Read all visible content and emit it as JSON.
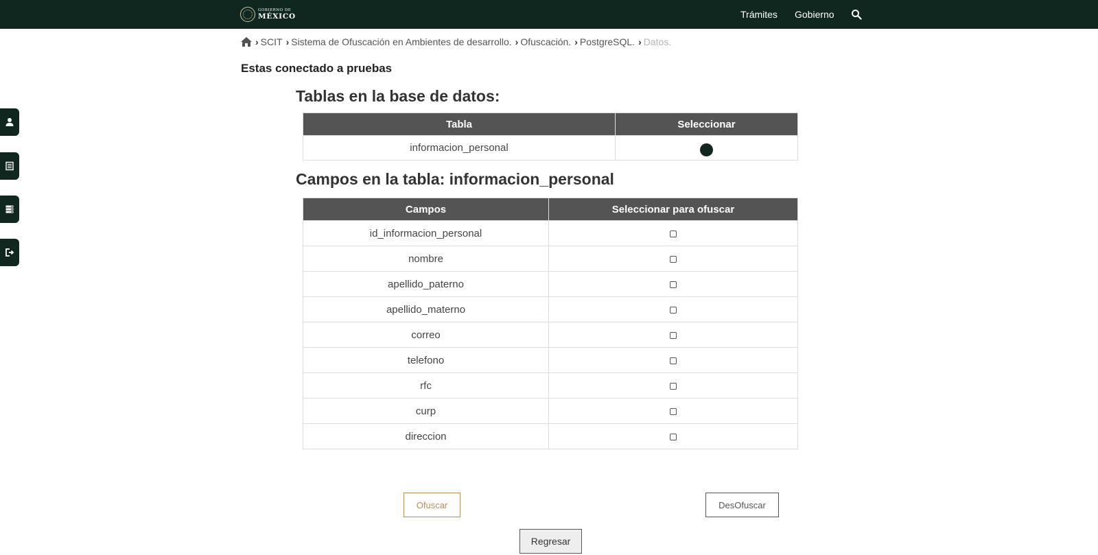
{
  "header": {
    "logo_line1": "GOBIERNO DE",
    "logo_line2": "MÉXICO",
    "nav": [
      "Trámites",
      "Gobierno"
    ],
    "search_icon": "search-icon"
  },
  "sidebar": {
    "tabs": [
      {
        "icon": "user-icon"
      },
      {
        "icon": "list-icon"
      },
      {
        "icon": "server-icon"
      },
      {
        "icon": "logout-icon"
      }
    ]
  },
  "breadcrumb": {
    "items": [
      "SCIT",
      "Sistema de Ofuscación en Ambientes de desarrollo.",
      "Ofuscación.",
      "PostgreSQL.",
      "Datos."
    ]
  },
  "connection_text": "Estas conectado a pruebas",
  "tables_section": {
    "title": "Tablas en la base de datos:",
    "headers": [
      "Tabla",
      "Seleccionar"
    ],
    "rows": [
      {
        "name": "informacion_personal",
        "selected": true
      }
    ]
  },
  "fields_section": {
    "title": "Campos en la tabla: informacion_personal",
    "headers": [
      "Campos",
      "Seleccionar para ofuscar"
    ],
    "rows": [
      {
        "name": "id_informacion_personal",
        "checked": false
      },
      {
        "name": "nombre",
        "checked": false
      },
      {
        "name": "apellido_paterno",
        "checked": false
      },
      {
        "name": "apellido_materno",
        "checked": false
      },
      {
        "name": "correo",
        "checked": false
      },
      {
        "name": "telefono",
        "checked": false
      },
      {
        "name": "rfc",
        "checked": false
      },
      {
        "name": "curp",
        "checked": false
      },
      {
        "name": "direccion",
        "checked": false
      }
    ]
  },
  "actions": {
    "ofuscar": "Ofuscar",
    "desofuscar": "DesOfuscar",
    "regresar": "Regresar"
  },
  "colors": {
    "header_bg": "#10271f",
    "table_header_bg": "#545454",
    "accent_gold": "#b38e5d"
  }
}
